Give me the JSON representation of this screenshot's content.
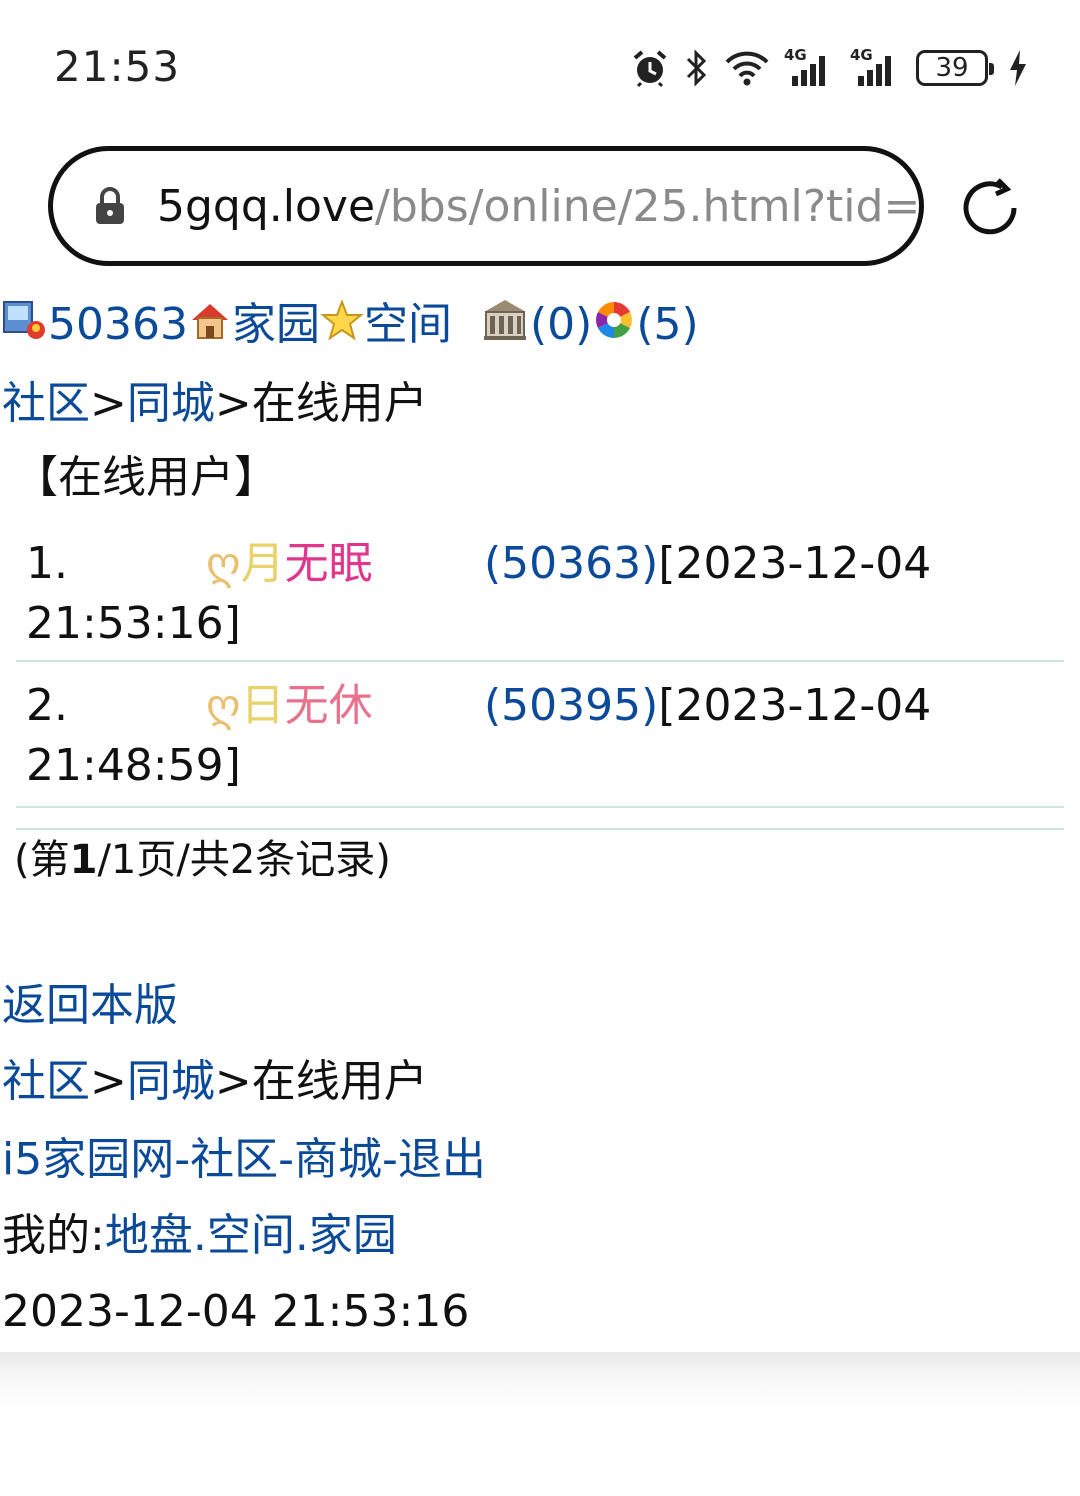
{
  "status_bar": {
    "time": "21:53",
    "network_labels": [
      "4G",
      "4G"
    ],
    "battery": "39",
    "icons": [
      "alarm-icon",
      "bluetooth-icon",
      "wifi-icon",
      "signal-icon",
      "signal-icon",
      "battery-icon",
      "charging-icon"
    ]
  },
  "browser": {
    "url_host": "5gqq.love",
    "url_path": "/bbs/online/25.html?tid="
  },
  "top_bar": {
    "user_id": "50363",
    "home_link": "家园",
    "space_link": "空间",
    "msg_count": "(0)",
    "color_count": "(5)"
  },
  "breadcrumb": {
    "community": "社区",
    "sep1": ">",
    "city": "同城",
    "sep2": ">",
    "current": "在线用户"
  },
  "section_title": "【在线用户】",
  "online_users": [
    {
      "index": "1.",
      "prefix": "ღ",
      "name_a": "月",
      "name_b": "无眠",
      "id": "(50363)",
      "time_a": "[2023-12-04",
      "time_b": "21:53:16]"
    },
    {
      "index": "2.",
      "prefix": "ღ",
      "name_a": "日",
      "name_b": "无休",
      "id": "(50395)",
      "time_a": "[2023-12-04",
      "time_b": "21:48:59]"
    }
  ],
  "pagination": {
    "open": "(第",
    "page": "1",
    "rest": "/1页/共2条记录)"
  },
  "back_link": "返回本版",
  "footer_links": {
    "site": "i5家园网",
    "dash": "-",
    "community": "社区",
    "mall": "商城",
    "logout": "退出"
  },
  "my_links": {
    "label": "我的:",
    "land": "地盘",
    "dot": ".",
    "space": "空间",
    "home": "家园"
  },
  "server_time": "2023-12-04 21:53:16",
  "colors": {
    "link": "#0b4a99",
    "name_a": "#e8d26a",
    "name_b": "#e0368e",
    "name_b2": "#e8728e",
    "prefix": "#e9c070",
    "divider": "#c9e6e0"
  }
}
